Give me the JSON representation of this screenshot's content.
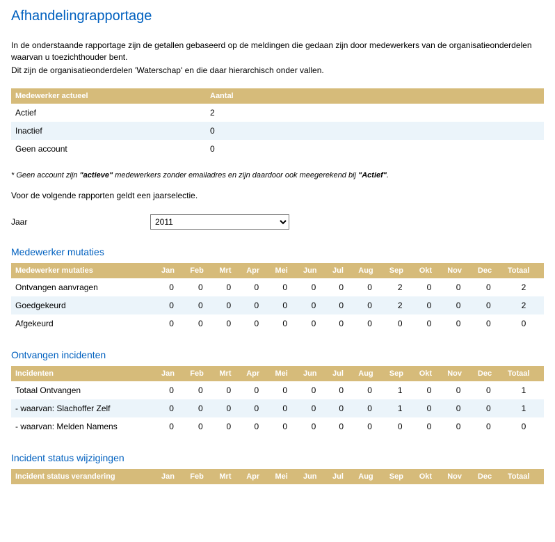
{
  "page_title": "Afhandelingrapportage",
  "intro_line1": "In de onderstaande rapportage zijn de getallen gebaseerd op de meldingen die gedaan zijn door medewerkers van de organisatieonderdelen waarvan u toezichthouder bent.",
  "intro_line2": "Dit zijn de organisatieonderdelen 'Waterschap' en die daar hierarchisch onder vallen.",
  "table_medewerker": {
    "col_label": "Medewerker actueel",
    "col_count": "Aantal",
    "rows": [
      {
        "label": "Actief",
        "count": "2"
      },
      {
        "label": "Inactief",
        "count": "0"
      },
      {
        "label": "Geen account",
        "count": "0"
      }
    ]
  },
  "footnote_prefix": "* Geen account zijn ",
  "footnote_quoted": "\"actieve\"",
  "footnote_suffix": " medewerkers zonder emailadres en zijn daardoor ook meegerekend bij ",
  "footnote_quoted2": "\"Actief\"",
  "footnote_end": ".",
  "year_intro": "Voor de volgende rapporten geldt een jaarselectie.",
  "year_label": "Jaar",
  "year_value": "2011",
  "month_headers": {
    "jan": "Jan",
    "feb": "Feb",
    "mrt": "Mrt",
    "apr": "Apr",
    "mei": "Mei",
    "jun": "Jun",
    "jul": "Jul",
    "aug": "Aug",
    "sep": "Sep",
    "okt": "Okt",
    "nov": "Nov",
    "dec": "Dec",
    "totaal": "Totaal"
  },
  "section_mutaties": {
    "title": "Medewerker mutaties",
    "head": "Medewerker mutaties",
    "rows": [
      {
        "label": "Ontvangen aanvragen",
        "v": [
          "0",
          "0",
          "0",
          "0",
          "0",
          "0",
          "0",
          "0",
          "2",
          "0",
          "0",
          "0",
          "2"
        ]
      },
      {
        "label": "Goedgekeurd",
        "v": [
          "0",
          "0",
          "0",
          "0",
          "0",
          "0",
          "0",
          "0",
          "2",
          "0",
          "0",
          "0",
          "2"
        ]
      },
      {
        "label": "Afgekeurd",
        "v": [
          "0",
          "0",
          "0",
          "0",
          "0",
          "0",
          "0",
          "0",
          "0",
          "0",
          "0",
          "0",
          "0"
        ]
      }
    ]
  },
  "section_incidenten": {
    "title": "Ontvangen incidenten",
    "head": "Incidenten",
    "rows": [
      {
        "label": "Totaal Ontvangen",
        "v": [
          "0",
          "0",
          "0",
          "0",
          "0",
          "0",
          "0",
          "0",
          "1",
          "0",
          "0",
          "0",
          "1"
        ]
      },
      {
        "label": " - waarvan: Slachoffer Zelf",
        "v": [
          "0",
          "0",
          "0",
          "0",
          "0",
          "0",
          "0",
          "0",
          "1",
          "0",
          "0",
          "0",
          "1"
        ]
      },
      {
        "label": " - waarvan: Melden Namens",
        "v": [
          "0",
          "0",
          "0",
          "0",
          "0",
          "0",
          "0",
          "0",
          "0",
          "0",
          "0",
          "0",
          "0"
        ]
      }
    ]
  },
  "section_status": {
    "title": "Incident status wijzigingen",
    "head": "Incident status verandering"
  },
  "chart_data": [
    {
      "type": "table",
      "title": "Medewerker actueel",
      "categories": [
        "Actief",
        "Inactief",
        "Geen account"
      ],
      "values": [
        2,
        0,
        0
      ]
    },
    {
      "type": "table",
      "title": "Medewerker mutaties",
      "categories": [
        "Jan",
        "Feb",
        "Mrt",
        "Apr",
        "Mei",
        "Jun",
        "Jul",
        "Aug",
        "Sep",
        "Okt",
        "Nov",
        "Dec",
        "Totaal"
      ],
      "series": [
        {
          "name": "Ontvangen aanvragen",
          "values": [
            0,
            0,
            0,
            0,
            0,
            0,
            0,
            0,
            2,
            0,
            0,
            0,
            2
          ]
        },
        {
          "name": "Goedgekeurd",
          "values": [
            0,
            0,
            0,
            0,
            0,
            0,
            0,
            0,
            2,
            0,
            0,
            0,
            2
          ]
        },
        {
          "name": "Afgekeurd",
          "values": [
            0,
            0,
            0,
            0,
            0,
            0,
            0,
            0,
            0,
            0,
            0,
            0,
            0
          ]
        }
      ]
    },
    {
      "type": "table",
      "title": "Ontvangen incidenten",
      "categories": [
        "Jan",
        "Feb",
        "Mrt",
        "Apr",
        "Mei",
        "Jun",
        "Jul",
        "Aug",
        "Sep",
        "Okt",
        "Nov",
        "Dec",
        "Totaal"
      ],
      "series": [
        {
          "name": "Totaal Ontvangen",
          "values": [
            0,
            0,
            0,
            0,
            0,
            0,
            0,
            0,
            1,
            0,
            0,
            0,
            1
          ]
        },
        {
          "name": "- waarvan: Slachoffer Zelf",
          "values": [
            0,
            0,
            0,
            0,
            0,
            0,
            0,
            0,
            1,
            0,
            0,
            0,
            1
          ]
        },
        {
          "name": "- waarvan: Melden Namens",
          "values": [
            0,
            0,
            0,
            0,
            0,
            0,
            0,
            0,
            0,
            0,
            0,
            0,
            0
          ]
        }
      ]
    }
  ]
}
